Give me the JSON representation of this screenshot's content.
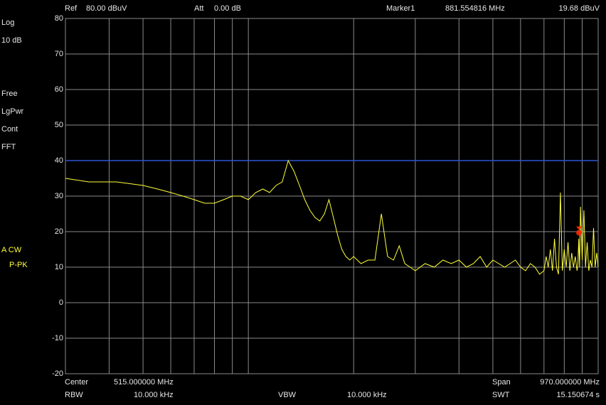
{
  "header": {
    "ref_label": "Ref",
    "ref_value": "80.00 dBuV",
    "att_label": "Att",
    "att_value": "0.00 dB",
    "marker_label": "Marker1",
    "marker_freq": "881.554816 MHz",
    "marker_level": "19.68 dBuV"
  },
  "side": {
    "scale_type": "Log",
    "scale_div": "10 dB",
    "trigger": "Free",
    "detector": "LgPwr",
    "sweep": "Cont",
    "mode": "FFT",
    "trace": "A CW",
    "trace_detector": "P-PK"
  },
  "footer": {
    "center_label": "Center",
    "center_value": "515.000000 MHz",
    "span_label": "Span",
    "span_value": "970.000000 MHz",
    "rbw_label": "RBW",
    "rbw_value": "10.000 kHz",
    "vbw_label": "VBW",
    "vbw_value": "10.000 kHz",
    "swt_label": "SWT",
    "swt_value": "15.150674 s"
  },
  "colors": {
    "trace": "#ffff3a",
    "limit_line": "#2e55d6",
    "grid": "#8a8a8a",
    "marker": "#ff2a00"
  },
  "chart_data": {
    "type": "line",
    "ylim": [
      -20,
      80
    ],
    "xlim": [
      30,
      1000
    ],
    "x_unit": "MHz",
    "y_unit": "dBuV",
    "y_ticks": [
      "80",
      "70",
      "60",
      "50",
      "40",
      "30",
      "20",
      "10",
      "0",
      "-10",
      "-20"
    ],
    "x_grid_log_spacing": true,
    "limit_line_y": 40,
    "marker": {
      "x": 881.554816,
      "y": 19.68
    },
    "trace": {
      "x": [
        30,
        35,
        42,
        50,
        55,
        60,
        65,
        70,
        75,
        80,
        85,
        90,
        95,
        100,
        105,
        110,
        115,
        120,
        125,
        130,
        135,
        140,
        145,
        150,
        155,
        160,
        165,
        170,
        175,
        180,
        185,
        190,
        195,
        200,
        210,
        220,
        230,
        240,
        250,
        260,
        270,
        280,
        290,
        300,
        320,
        340,
        360,
        380,
        400,
        420,
        440,
        460,
        480,
        500,
        520,
        540,
        560,
        580,
        600,
        620,
        640,
        660,
        680,
        700,
        710,
        720,
        730,
        740,
        750,
        760,
        770,
        780,
        790,
        800,
        810,
        820,
        830,
        840,
        850,
        860,
        870,
        875,
        880,
        885,
        890,
        900,
        910,
        920,
        930,
        940,
        950,
        960,
        970,
        980,
        990,
        1000
      ],
      "y": [
        35,
        34,
        34,
        33,
        32,
        31,
        30,
        29,
        28,
        28,
        29,
        30,
        30,
        29,
        31,
        32,
        31,
        33,
        34,
        40,
        37,
        33,
        29,
        26,
        24,
        23,
        25,
        29,
        24,
        19,
        15,
        13,
        12,
        13,
        11,
        12,
        12,
        25,
        13,
        12,
        16,
        11,
        10,
        9,
        11,
        10,
        12,
        11,
        12,
        10,
        11,
        13,
        10,
        12,
        11,
        10,
        11,
        12,
        10,
        9,
        11,
        10,
        8,
        9,
        13,
        10,
        15,
        9,
        18,
        10,
        8,
        31,
        9,
        15,
        10,
        17,
        9,
        14,
        10,
        13,
        9,
        11,
        18,
        10,
        27,
        12,
        26,
        10,
        17,
        9,
        12,
        10,
        21,
        10,
        14,
        10
      ]
    }
  }
}
